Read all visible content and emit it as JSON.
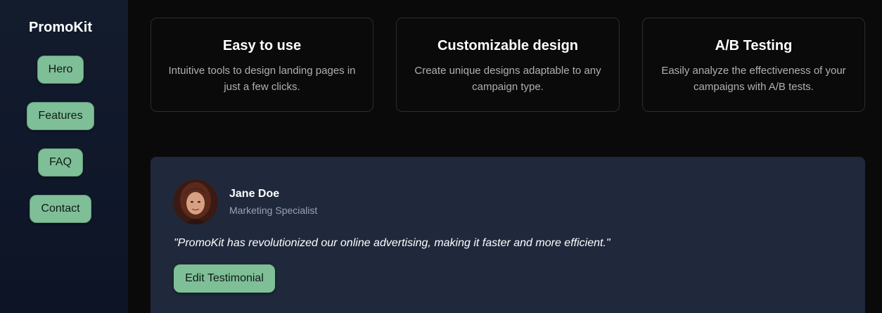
{
  "brand": "PromoKit",
  "nav": {
    "items": [
      {
        "label": "Hero"
      },
      {
        "label": "Features"
      },
      {
        "label": "FAQ"
      },
      {
        "label": "Contact"
      }
    ]
  },
  "features": [
    {
      "title": "Easy to use",
      "description": "Intuitive tools to design landing pages in just a few clicks."
    },
    {
      "title": "Customizable design",
      "description": "Create unique designs adaptable to any campaign type."
    },
    {
      "title": "A/B Testing",
      "description": "Easily analyze the effectiveness of your campaigns with A/B tests."
    }
  ],
  "testimonial": {
    "author_name": "Jane Doe",
    "author_role": "Marketing Specialist",
    "quote": "\"PromoKit has revolutionized our online advertising, making it faster and more efficient.\"",
    "edit_label": "Edit Testimonial"
  },
  "colors": {
    "accent": "#7fbf98",
    "sidebar_bg": "#0f172a",
    "card_bg": "#1f293b"
  }
}
